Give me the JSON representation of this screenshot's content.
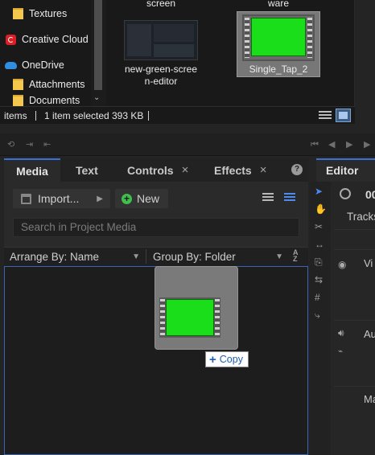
{
  "explorer": {
    "nav_items": [
      {
        "label": "Textures",
        "icon": "folder-icon"
      },
      {
        "label": "Creative Cloud F",
        "icon": "creative-cloud-icon"
      },
      {
        "label": "OneDrive",
        "icon": "onedrive-icon"
      },
      {
        "label": "Attachments",
        "icon": "folder-icon"
      },
      {
        "label": "Documents",
        "icon": "folder-icon"
      }
    ],
    "files": {
      "top_left_label": "screen",
      "top_right_label": "ware",
      "editor_file_label": "new-green-scree\nn-editor",
      "selected_file_label": "Single_Tap_2"
    },
    "status": {
      "items_text": "items",
      "selected_text": "1 item selected",
      "size_text": "393 KB"
    }
  },
  "media_panel": {
    "tabs": [
      {
        "label": "Media",
        "active": true
      },
      {
        "label": "Text"
      },
      {
        "label": "Controls",
        "closable": true
      },
      {
        "label": "Effects",
        "closable": true
      }
    ],
    "close_glyph": "×",
    "help_glyph": "?",
    "import_label": "Import...",
    "new_label": "New",
    "search_placeholder": "Search in Project Media",
    "arrange_label": "Arrange By: Name",
    "group_label": "Group By: Folder",
    "drag_tooltip": "Copy",
    "drag_tooltip_glyph": "+"
  },
  "editor": {
    "tab_label": "Editor",
    "timecode": "00",
    "tracks_label": "Tracks",
    "video_label": "Vi",
    "audio_label": "Au",
    "master_label": "Ma"
  },
  "colors": {
    "accent": "#3b6fd6",
    "green_screen": "#1bde1b",
    "new_icon": "#3fbf4b"
  }
}
